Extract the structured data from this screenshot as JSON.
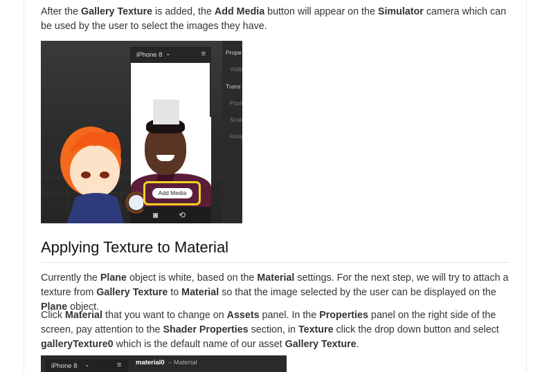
{
  "intro": {
    "t1": "After the ",
    "b1": "Gallery Texture",
    "t2": " is added, the ",
    "b2": "Add Media",
    "t3": " button will appear on the ",
    "b3": "Simulator",
    "t4": " camera which can be used by the user to select the images they have."
  },
  "figure1": {
    "device_model": "iPhone 8",
    "chevron_icon": "chevron-down-icon",
    "menu_icon": "hamburger-menu-icon",
    "add_media_label": "Add Media",
    "highlight_color": "#f1d51e",
    "camera_icon": "camera-icon",
    "flip_icon": "rotate-device-icon",
    "panel_rows": [
      "Prope",
      "Visib",
      "Trans",
      "Positi",
      "Scale",
      "Rotati"
    ]
  },
  "section": {
    "title": "Applying Texture to Material"
  },
  "para2": {
    "t1": "Currently the ",
    "b1": "Plane",
    "t2": " object is white, based on the ",
    "b2": "Material",
    "t3": " settings. For the next step, we will try to attach a texture from ",
    "b3": "Gallery Texture",
    "t4": " to ",
    "b4": "Material",
    "t5": " so that the image selected by the user can be displayed on the ",
    "b5": "Plane",
    "t6": " object."
  },
  "para3": {
    "t1": "Click ",
    "b1": "Material",
    "t2": " that you want to change on ",
    "b2": "Assets",
    "t3": " panel. In the ",
    "b3": "Properties",
    "t4": " panel on the right side of the screen, pay attention to the ",
    "b4": "Shader Properties",
    "t5": " section, in ",
    "b5": "Texture",
    "t6": " click the drop down button and select ",
    "b6": "galleryTexture0",
    "t7": " which is the default name of our asset ",
    "b7": "Gallery Texture",
    "t8": "."
  },
  "figure2": {
    "device_model": "iPhone 8",
    "material_name": "material0",
    "material_sub": "– Material"
  }
}
